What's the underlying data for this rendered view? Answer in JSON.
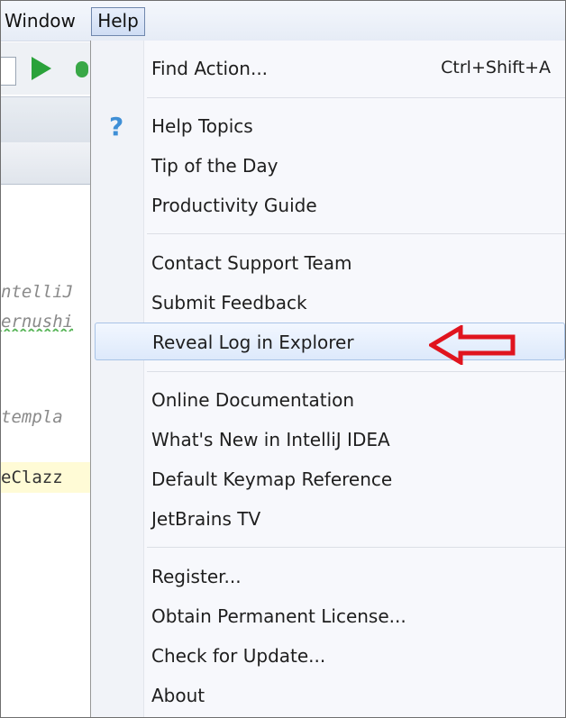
{
  "menubar": {
    "window_label": "Window",
    "help_label": "Help"
  },
  "editor": {
    "lines": [
      "ntelliJ",
      "ernushi",
      "templa",
      "eClazz"
    ]
  },
  "help_menu": {
    "items": [
      {
        "label": "Find Action...",
        "shortcut": "Ctrl+Shift+A"
      },
      {
        "label": "Help Topics",
        "icon": "question-mark-icon"
      },
      {
        "label": "Tip of the Day"
      },
      {
        "label": "Productivity Guide"
      },
      {
        "label": "Contact Support Team"
      },
      {
        "label": "Submit Feedback"
      },
      {
        "label": "Reveal Log in Explorer",
        "highlighted": true
      },
      {
        "label": "Online Documentation"
      },
      {
        "label": "What's New in IntelliJ IDEA"
      },
      {
        "label": "Default Keymap Reference"
      },
      {
        "label": "JetBrains TV"
      },
      {
        "label": "Register..."
      },
      {
        "label": "Obtain Permanent License..."
      },
      {
        "label": "Check for Update..."
      },
      {
        "label": "About"
      }
    ]
  },
  "colors": {
    "highlight_border": "#a8c3e6",
    "annotation_arrow": "#e0141e",
    "help_icon": "#3f8fd6"
  }
}
